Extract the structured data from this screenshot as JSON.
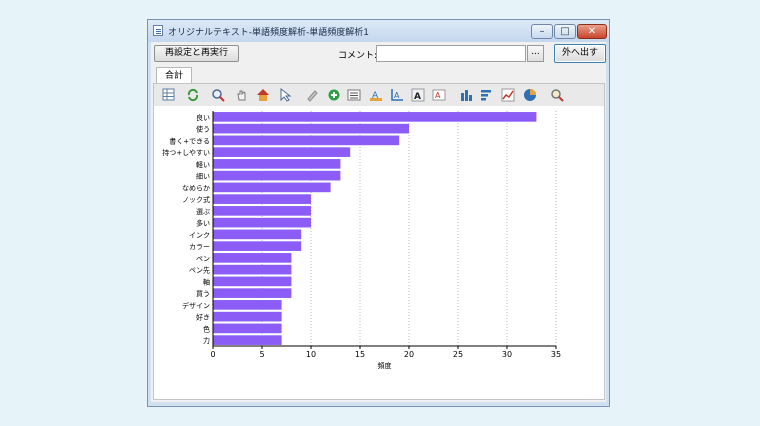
{
  "window": {
    "title": "オリジナルテキスト-単語頻度解析-単語頻度解析1",
    "min_glyph": "–",
    "max_glyph": "□",
    "close_glyph": "✕"
  },
  "header": {
    "rerun_label": "再設定と再実行",
    "comment_label": "コメント:",
    "comment_value": "",
    "comment_dots": "...",
    "export_label": "外へ出す"
  },
  "tabs": [
    {
      "label": "合計"
    }
  ],
  "toolbar": {
    "icons": [
      "table-icon",
      "refresh-icon",
      "zoom-icon",
      "pan-hand-icon",
      "home-icon",
      "pointer-icon",
      "brush-icon",
      "add-icon",
      "list-icon",
      "text-style-icon",
      "axis-icon",
      "font-icon",
      "label-icon",
      "bar-chart-icon",
      "horizontal-bar-icon",
      "line-chart-icon",
      "pie-chart-icon",
      "search-settings-icon"
    ]
  },
  "colors": {
    "bar": "#8b5cf6",
    "grid": "#b8b8b8"
  },
  "chart_data": {
    "type": "bar",
    "orientation": "horizontal",
    "categories": [
      "良い",
      "使う",
      "書く+できる",
      "持つ+しやすい",
      "軽い",
      "細い",
      "なめらか",
      "ノック式",
      "選ぶ",
      "多い",
      "インク",
      "カラー",
      "ペン",
      "ペン先",
      "軸",
      "買う",
      "デザイン",
      "好き",
      "色",
      "力"
    ],
    "values": [
      33,
      20,
      19,
      14,
      13,
      13,
      12,
      10,
      10,
      10,
      9,
      9,
      8,
      8,
      8,
      8,
      7,
      7,
      7,
      7
    ],
    "xlabel": "頻度",
    "ylabel": "",
    "xlim": [
      0,
      35
    ],
    "xticks": [
      0,
      5,
      10,
      15,
      20,
      25,
      30,
      35
    ],
    "grid": "vertical dotted"
  }
}
